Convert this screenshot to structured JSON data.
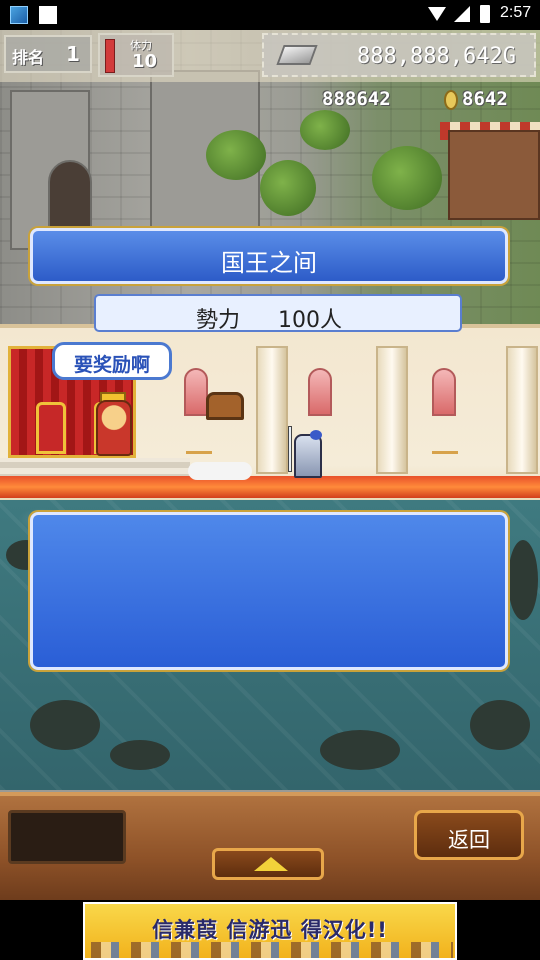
{
  "status_bar": {
    "time": "2:57"
  },
  "hud": {
    "rank_label": "排名",
    "rank_value": "1",
    "stamina_label": "体力",
    "stamina_value": "10",
    "gold": "888,888,642G",
    "resource_a": "888642",
    "resource_b": "8642"
  },
  "room": {
    "title": "国王之间",
    "power_label": "勢力",
    "power_value": "100人",
    "reward_button": "要奖励啊"
  },
  "message": {
    "text": ""
  },
  "bottom": {
    "back_label": "返回"
  },
  "ad": {
    "text": "信兼葭 信游迅 得汉化!!"
  },
  "colors": {
    "panel_blue": "#2d5cc8",
    "panel_border": "#dfe8ff",
    "wood": "#8e5228",
    "carpet": "#e8502a"
  },
  "icons": [
    "app-icon",
    "wifi-icon",
    "signal-icon",
    "battery-icon",
    "silver-ingot-icon",
    "coin-icon",
    "up-arrow-icon"
  ]
}
